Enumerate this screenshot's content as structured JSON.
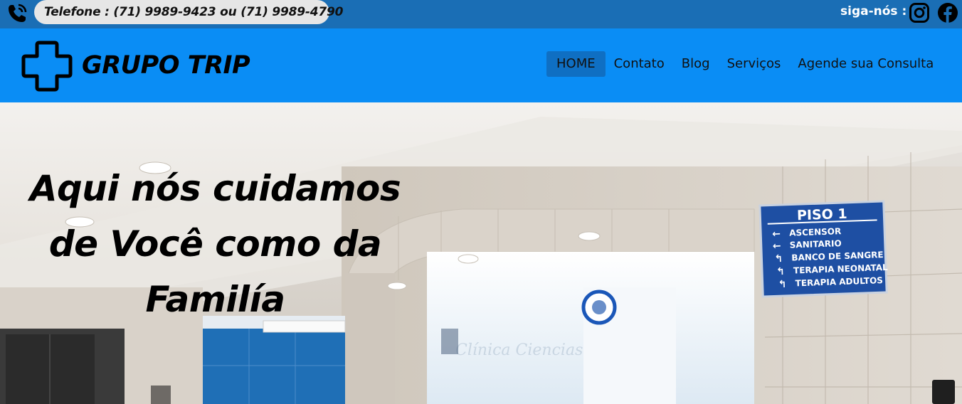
{
  "topbar": {
    "phone_text": "Telefone : (71) 9989-9423 ou (71) 9989-4790",
    "follow_label": "siga-nós :",
    "icons": [
      "phone-icon",
      "instagram-icon",
      "facebook-icon"
    ]
  },
  "header": {
    "brand": "GRUPO TRIP",
    "logo_icon": "medical-cross-icon",
    "nav": [
      {
        "label": "HOME",
        "active": true
      },
      {
        "label": "Contato",
        "active": false
      },
      {
        "label": "Blog",
        "active": false
      },
      {
        "label": "Serviços",
        "active": false
      },
      {
        "label": "Agende sua Consulta",
        "active": false
      }
    ]
  },
  "hero": {
    "headline": "Aqui nós cuidamos de Você como da Familía",
    "sign": {
      "title": "PISO 1",
      "lines": [
        "ASCENSOR",
        "SANITARIO",
        "BANCO DE SANGRE",
        "TERAPIA NEONATAL",
        "TERAPIA ADULTOS"
      ]
    },
    "glass_text": "Clínica Ciencias"
  },
  "colors": {
    "topbar": "#1a6eb5",
    "header": "#0a8df5",
    "nav_active": "#0f6fc3",
    "pill": "#e6e6e6"
  }
}
